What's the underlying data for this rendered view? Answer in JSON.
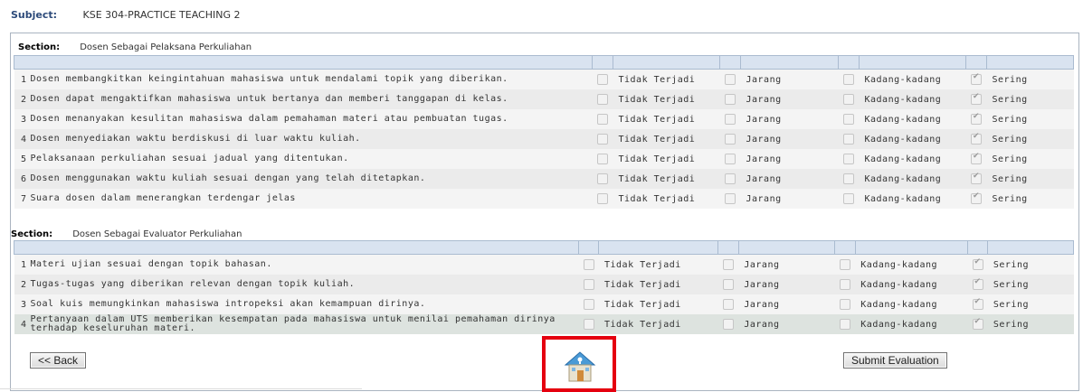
{
  "subject": {
    "label": "Subject:",
    "value": "KSE 304-PRACTICE TEACHING 2"
  },
  "options": [
    "Tidak Terjadi",
    "Jarang",
    "Kadang-kadang",
    "Sering"
  ],
  "sections": [
    {
      "label": "Section:",
      "title": "Dosen Sebagai Pelaksana Perkuliahan",
      "questions": [
        {
          "num": "1",
          "text": "Dosen membangkitkan keingintahuan mahasiswa untuk mendalami topik yang diberikan.",
          "checked": 3
        },
        {
          "num": "2",
          "text": "Dosen dapat mengaktifkan mahasiswa untuk bertanya dan memberi tanggapan di kelas.",
          "checked": 3
        },
        {
          "num": "3",
          "text": "Dosen menanyakan kesulitan mahasiswa dalam pemahaman materi atau pembuatan tugas.",
          "checked": 3
        },
        {
          "num": "4",
          "text": "Dosen menyediakan waktu berdiskusi di luar waktu kuliah.",
          "checked": 3
        },
        {
          "num": "5",
          "text": "Pelaksanaan perkuliahan sesuai jadual yang ditentukan.",
          "checked": 3
        },
        {
          "num": "6",
          "text": "Dosen menggunakan waktu kuliah sesuai dengan yang telah ditetapkan.",
          "checked": 3
        },
        {
          "num": "7",
          "text": "Suara dosen dalam menerangkan terdengar jelas",
          "checked": 3
        }
      ]
    },
    {
      "label": "Section:",
      "title": "Dosen Sebagai Evaluator Perkuliahan",
      "questions": [
        {
          "num": "1",
          "text": "Materi ujian sesuai dengan topik bahasan.",
          "checked": 3
        },
        {
          "num": "2",
          "text": "Tugas-tugas yang diberikan relevan dengan topik kuliah.",
          "checked": 3
        },
        {
          "num": "3",
          "text": "Soal kuis memungkinkan mahasiswa intropeksi akan kemampuan dirinya.",
          "checked": 3
        },
        {
          "num": "4",
          "text": "Pertanyaan dalam UTS memberikan kesempatan pada mahasiswa untuk menilai pemahaman dirinya terhadap keseluruhan materi.",
          "checked": 3
        }
      ]
    }
  ],
  "buttons": {
    "back": "<< Back",
    "submit": "Submit Evaluation"
  },
  "icons": {
    "home": "home-icon"
  },
  "colors": {
    "highlight_box": "#e5000f",
    "header_row": "#d9e3f0",
    "label_blue": "#2c4a7a"
  }
}
